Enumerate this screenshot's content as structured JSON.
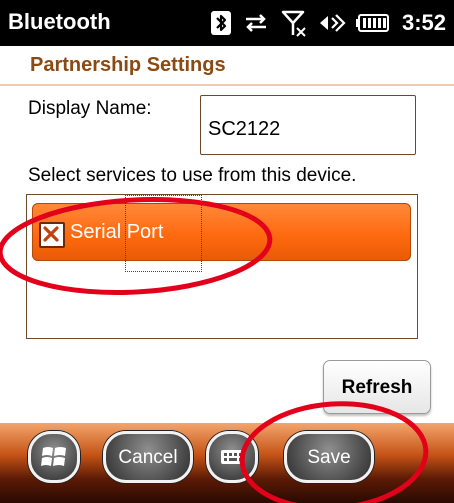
{
  "status": {
    "title": "Bluetooth",
    "time": "3:52",
    "icons": [
      "bluetooth-icon",
      "connectivity-arrows-icon",
      "signal-off-icon",
      "volume-icon",
      "battery-icon"
    ]
  },
  "header": {
    "title": "Partnership Settings",
    "accent_color": "#8b4a12"
  },
  "form": {
    "display_name_label": "Display Name:",
    "display_name_value": "SC2122",
    "services_label": "Select services to use from this device."
  },
  "services": {
    "items": [
      {
        "label": "Serial Port",
        "checked": true
      }
    ],
    "selected_row_color": "#ff6a10"
  },
  "buttons": {
    "refresh": "Refresh"
  },
  "menubar": {
    "left_softkey": "Cancel",
    "right_softkey": "Save",
    "start_icon": "windows-start-icon",
    "keyboard_icon": "keyboard-icon"
  },
  "annotation_color": "#e3001b"
}
